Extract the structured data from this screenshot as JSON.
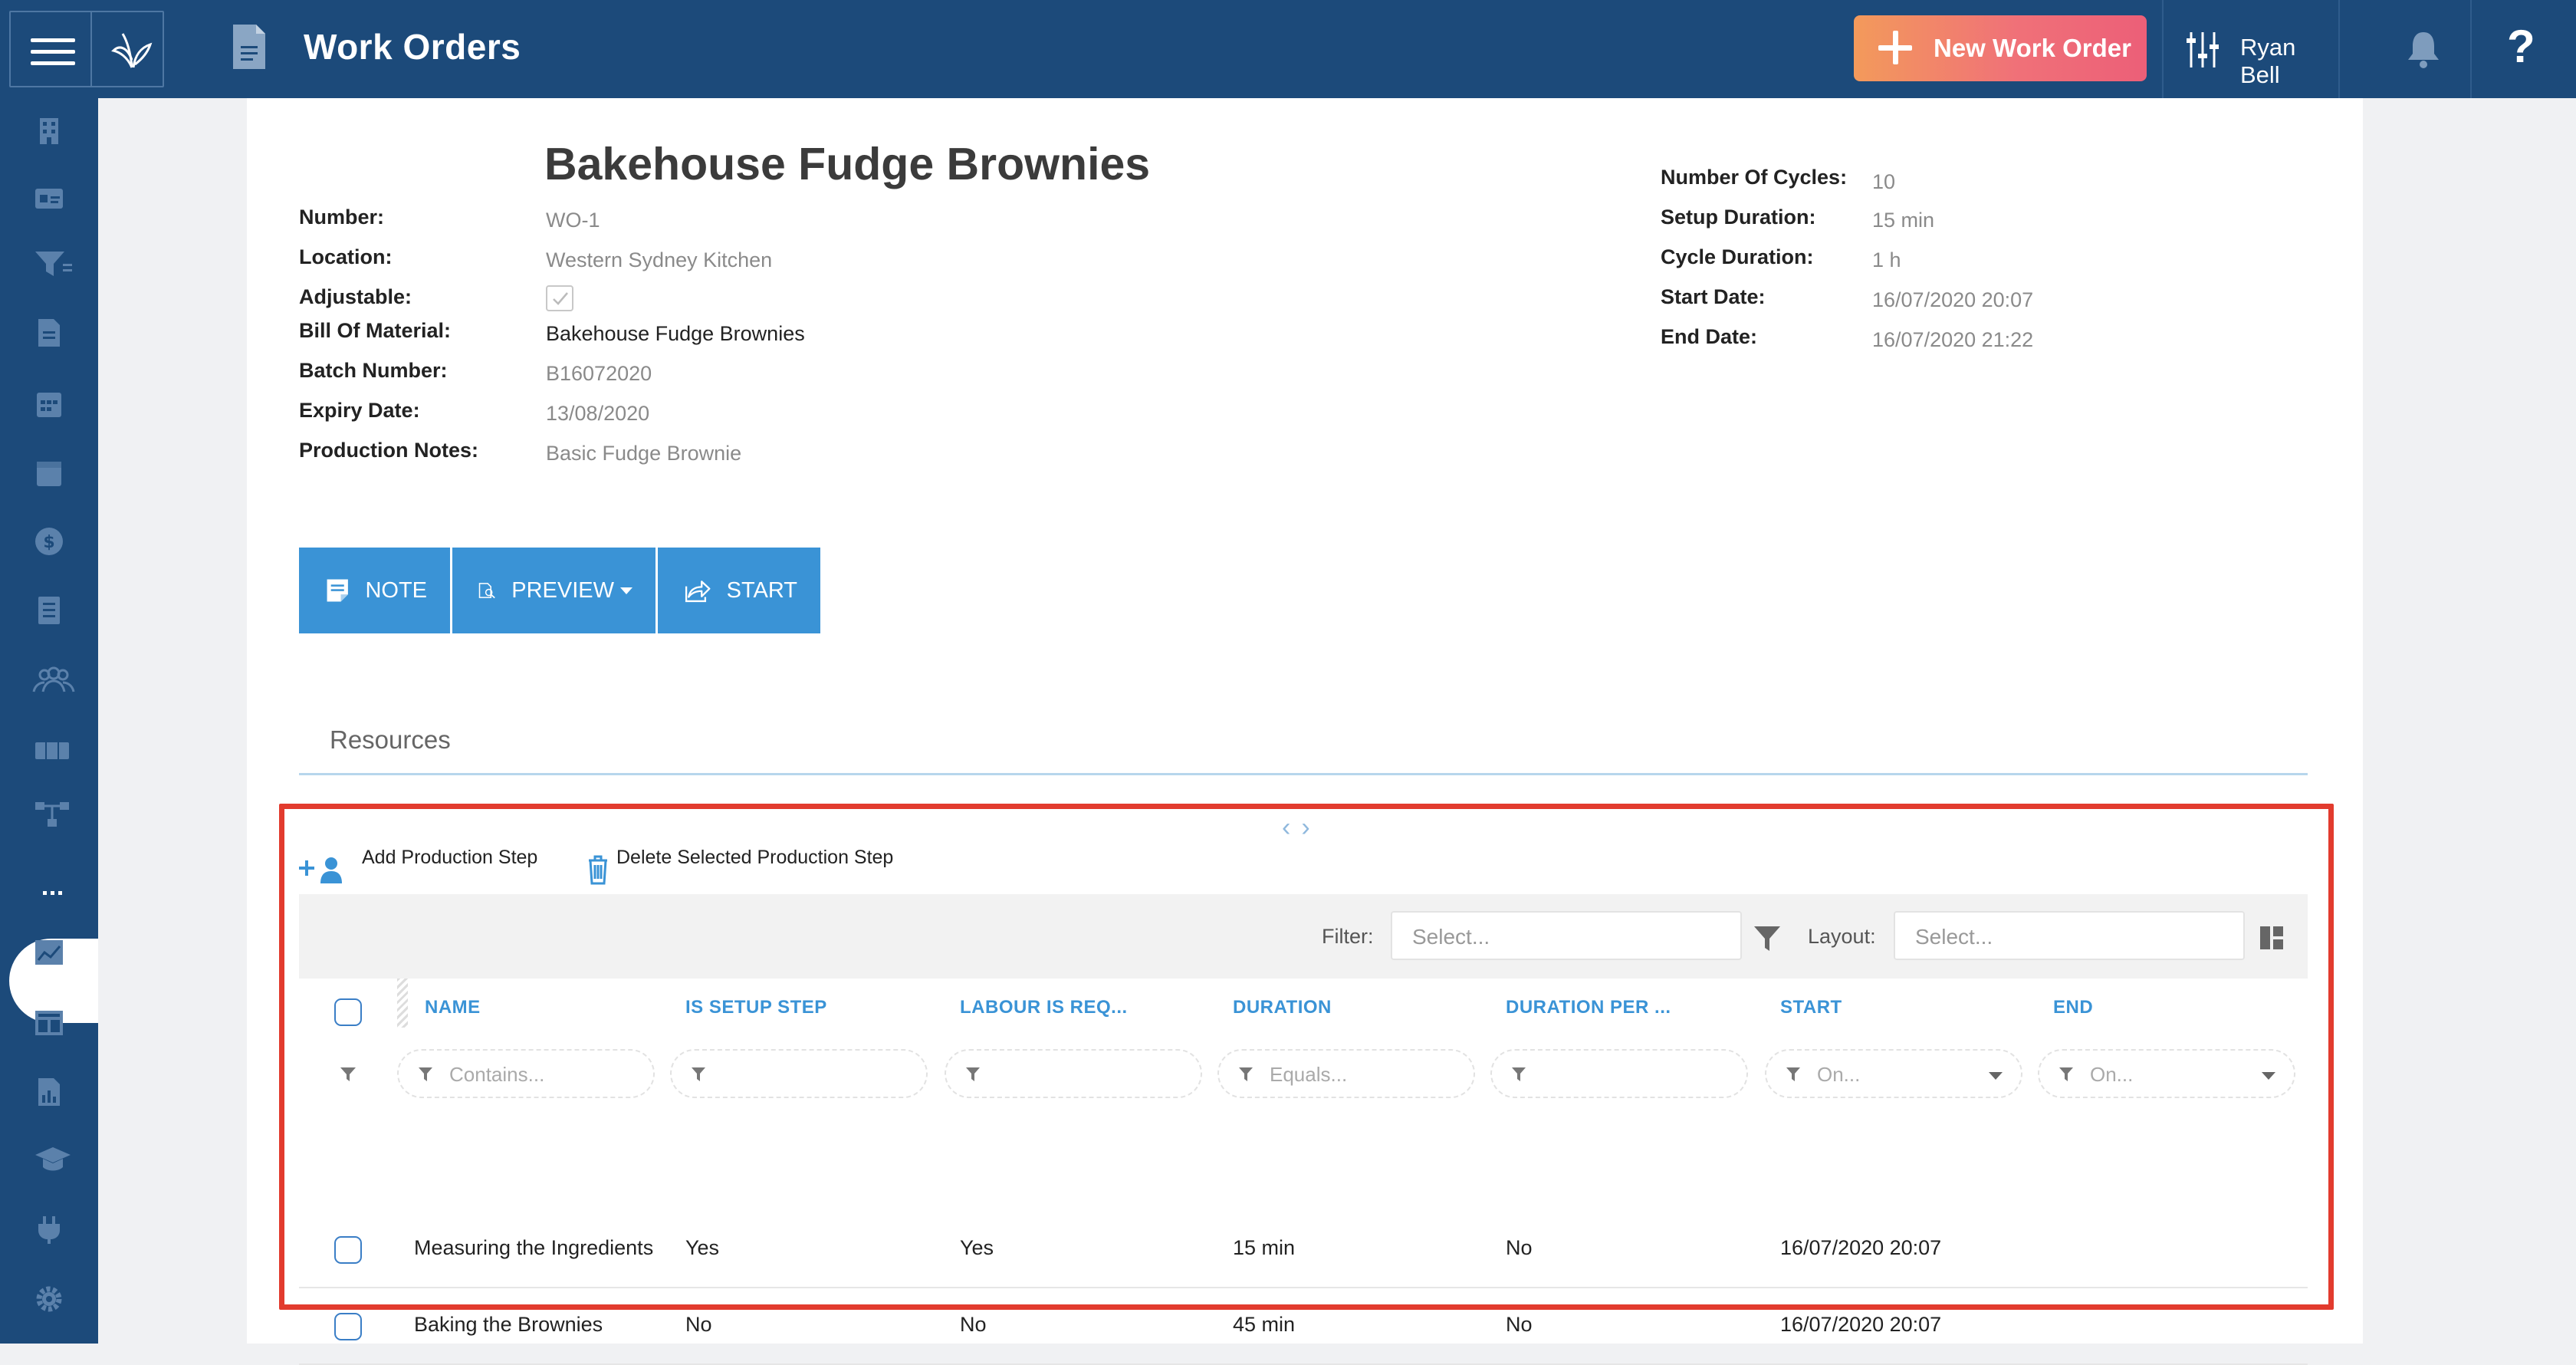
{
  "header": {
    "title": "Work Orders",
    "new_button": "New Work Order",
    "user_name": "Ryan Bell",
    "help_glyph": "?"
  },
  "work_order": {
    "title": "Bakehouse Fudge Brownies",
    "left_fields": [
      {
        "label": "Number:",
        "value": "WO-1"
      },
      {
        "label": "Location:",
        "value": "Western Sydney Kitchen"
      },
      {
        "label": "Adjustable:",
        "value": ""
      },
      {
        "label": "Bill Of Material:",
        "value": "Bakehouse Fudge Brownies"
      },
      {
        "label": "Batch Number:",
        "value": "B16072020"
      },
      {
        "label": "Expiry Date:",
        "value": "13/08/2020"
      },
      {
        "label": "Production Notes:",
        "value": "Basic Fudge Brownie"
      }
    ],
    "right_fields": [
      {
        "label": "Number Of Cycles:",
        "value": "10"
      },
      {
        "label": "Setup Duration:",
        "value": "15 min"
      },
      {
        "label": "Cycle Duration:",
        "value": "1 h"
      },
      {
        "label": "Start Date:",
        "value": "16/07/2020 20:07"
      },
      {
        "label": "End Date:",
        "value": "16/07/2020 21:22"
      }
    ]
  },
  "actions": {
    "note": "NOTE",
    "preview": "PREVIEW",
    "start": "START"
  },
  "tabs": {
    "resources": "Resources"
  },
  "grid": {
    "add_step": "Add Production Step",
    "delete_step": "Delete Selected Production Step",
    "filter_label": "Filter:",
    "filter_placeholder": "Select...",
    "layout_label": "Layout:",
    "layout_placeholder": "Select...",
    "columns": [
      "NAME",
      "IS SETUP STEP",
      "LABOUR IS REQ...",
      "DURATION",
      "DURATION PER ...",
      "START",
      "END"
    ],
    "column_filters": [
      "Contains...",
      "",
      "",
      "Equals...",
      "",
      "On...",
      "On..."
    ],
    "rows": [
      {
        "name": "Measuring the Ingredients",
        "is_setup": "Yes",
        "labour": "Yes",
        "duration": "15 min",
        "duration_per": "No",
        "start": "16/07/2020 20:07",
        "end": ""
      },
      {
        "name": "Baking the Brownies",
        "is_setup": "No",
        "labour": "No",
        "duration": "45 min",
        "duration_per": "No",
        "start": "16/07/2020 20:07",
        "end": ""
      }
    ]
  },
  "colors": {
    "primary": "#1c4a7a",
    "accent_blue": "#3a93d6",
    "highlight_red": "#e23b2e"
  }
}
